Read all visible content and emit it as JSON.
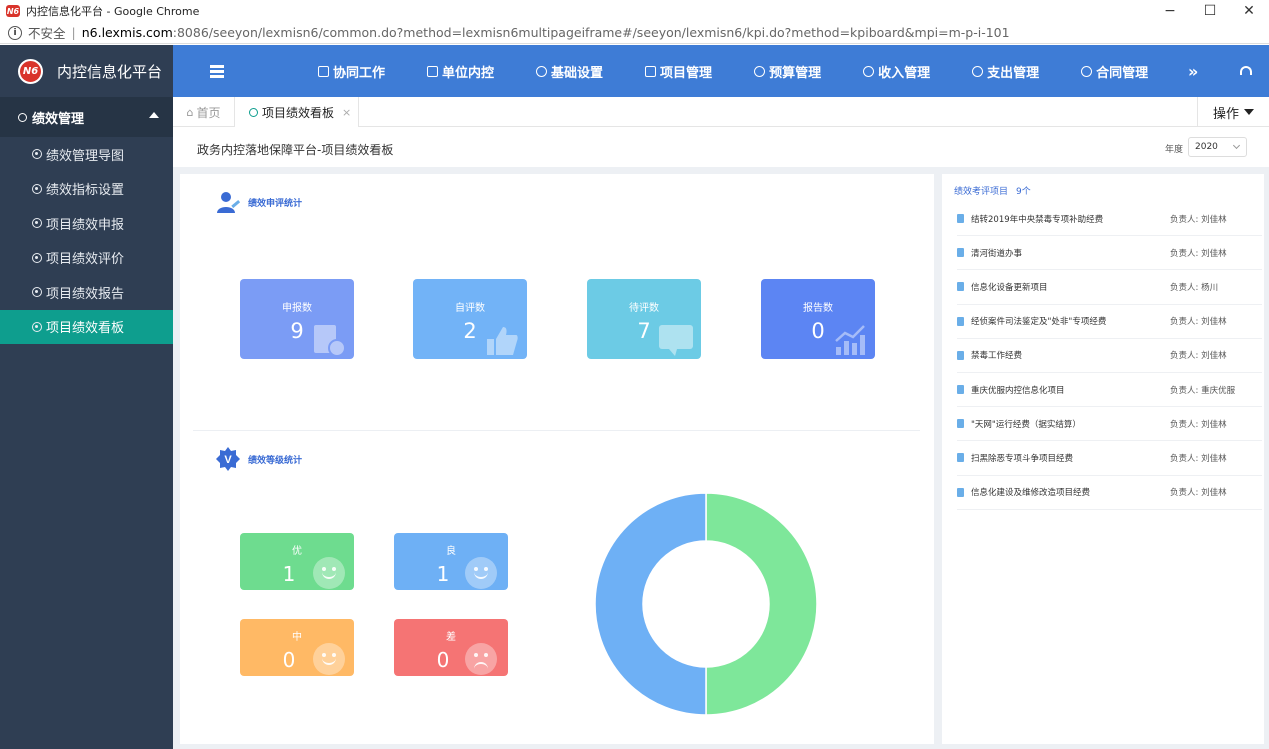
{
  "window": {
    "title": "内控信息化平台 - Google Chrome",
    "logo_text": "N6",
    "minimize": "−",
    "maximize": "☐",
    "close": "✕"
  },
  "address": {
    "info": "i",
    "insecure": "不安全",
    "separator": "|",
    "host": "n6.lexmis.com",
    "path": ":8086/seeyon/lexmisn6/common.do?method=lexmisn6multipageiframe#/seeyon/lexmisn6/kpi.do?method=kpiboard&mpi=m-p-i-101"
  },
  "brand": {
    "logo": "N6",
    "name": "内控信息化平台"
  },
  "topnav": {
    "items": [
      {
        "label": "协同工作"
      },
      {
        "label": "单位内控"
      },
      {
        "label": "基础设置"
      },
      {
        "label": "项目管理"
      },
      {
        "label": "预算管理"
      },
      {
        "label": "收入管理"
      },
      {
        "label": "支出管理"
      },
      {
        "label": "合同管理"
      }
    ],
    "more": "»"
  },
  "sidebar": {
    "header": "绩效管理",
    "items": [
      {
        "label": "绩效管理导图"
      },
      {
        "label": "绩效指标设置"
      },
      {
        "label": "项目绩效申报"
      },
      {
        "label": "项目绩效评价"
      },
      {
        "label": "项目绩效报告"
      },
      {
        "label": "项目绩效看板"
      }
    ]
  },
  "tabs": {
    "home": "首页",
    "active": "项目绩效看板",
    "close": "×",
    "ops": "操作"
  },
  "page": {
    "title": "政务内控落地保障平台-项目绩效看板",
    "year_label": "年度",
    "year_value": "2020"
  },
  "review_stats": {
    "title": "绩效申评统计",
    "cards": [
      {
        "label": "申报数",
        "value": "9",
        "color": "#7b9cf5"
      },
      {
        "label": "自评数",
        "value": "2",
        "color": "#72b3f7"
      },
      {
        "label": "待评数",
        "value": "7",
        "color": "#6ccbe5"
      },
      {
        "label": "报告数",
        "value": "0",
        "color": "#5c85f3"
      }
    ]
  },
  "grade_stats": {
    "title": "绩效等级统计",
    "badge": "V",
    "cards": [
      {
        "label": "优",
        "value": "1",
        "color": "#6edc8f"
      },
      {
        "label": "良",
        "value": "1",
        "color": "#6eb0f5"
      },
      {
        "label": "中",
        "value": "0",
        "color": "#ffb965"
      },
      {
        "label": "差",
        "value": "0",
        "color": "#f57474"
      }
    ]
  },
  "chart_data": {
    "type": "pie",
    "donut": true,
    "slices": [
      {
        "label": "优",
        "value": 1,
        "color": "#7ee79a"
      },
      {
        "label": "良",
        "value": 1,
        "color": "#6eb0f5"
      },
      {
        "label": "中",
        "value": 0,
        "color": "#ffb965"
      },
      {
        "label": "差",
        "value": 0,
        "color": "#f57474"
      }
    ]
  },
  "projects": {
    "title": "绩效考评项目",
    "count": "9个",
    "owner_prefix": "负责人: ",
    "items": [
      {
        "name": "结转2019年中央禁毒专项补助经费",
        "owner": "负责人:  刘佳林"
      },
      {
        "name": "清河街道办事",
        "owner": "负责人:  刘佳林"
      },
      {
        "name": "信息化设备更新项目",
        "owner": "负责人:  杨川"
      },
      {
        "name": "经侦案件司法鉴定及\"处非\"专项经费",
        "owner": "负责人:  刘佳林"
      },
      {
        "name": "禁毒工作经费",
        "owner": "负责人:  刘佳林"
      },
      {
        "name": "重庆优服内控信息化项目",
        "owner": "负责人:  重庆优服"
      },
      {
        "name": "\"天网\"运行经费（据实结算）",
        "owner": "负责人:  刘佳林"
      },
      {
        "name": "扫黑除恶专项斗争项目经费",
        "owner": "负责人:  刘佳林"
      },
      {
        "name": "信息化建设及维修改造项目经费",
        "owner": "负责人:  刘佳林"
      }
    ]
  }
}
